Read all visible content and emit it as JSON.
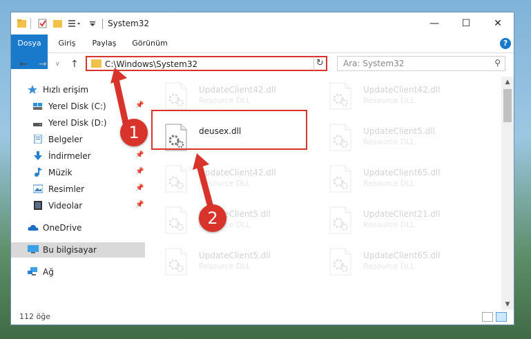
{
  "window": {
    "title": "System32",
    "minimize": "—",
    "maximize": "☐",
    "close": "✕"
  },
  "ribbon": {
    "tabs": [
      "Dosya",
      "Giriş",
      "Paylaş",
      "Görünüm"
    ],
    "help": "?"
  },
  "address": {
    "path": "C:\\Windows\\System32",
    "search_placeholder": "Ara: System32"
  },
  "sidebar": {
    "items": [
      {
        "label": "Hızlı erişim",
        "icon": "star-icon"
      },
      {
        "label": "Yerel Disk (C:)",
        "icon": "drive-icon",
        "pinned": true
      },
      {
        "label": "Yerel Disk (D:)",
        "icon": "drive-icon"
      },
      {
        "label": "Belgeler",
        "icon": "documents-icon",
        "pinned": true
      },
      {
        "label": "İndirmeler",
        "icon": "downloads-icon",
        "pinned": true
      },
      {
        "label": "Müzik",
        "icon": "music-icon",
        "pinned": true
      },
      {
        "label": "Resimler",
        "icon": "pictures-icon",
        "pinned": true
      },
      {
        "label": "Videolar",
        "icon": "videos-icon",
        "pinned": true
      },
      {
        "label": "OneDrive",
        "icon": "cloud-icon"
      },
      {
        "label": "Bu bilgisayar",
        "icon": "computer-icon",
        "selected": true
      },
      {
        "label": "Ağ",
        "icon": "network-icon"
      }
    ]
  },
  "files": [
    {
      "name": "UpdateClient42.dll",
      "type": "Resource DLL"
    },
    {
      "name": "UpdateClient42.dll",
      "type": "Resource DLL"
    },
    {
      "name": "deusex.dll",
      "type": ""
    },
    {
      "name": "UpdateClient5.dll",
      "type": "Resource DLL"
    },
    {
      "name": "UpdateClient42.dll",
      "type": "Resource DLL"
    },
    {
      "name": "UpdateClient65.dll",
      "type": "Resource DLL"
    },
    {
      "name": "UpdateClient5.dll",
      "type": "Resource DLL"
    },
    {
      "name": "UpdateClient21.dll",
      "type": "Resource DLL"
    },
    {
      "name": "UpdateClient5.dll",
      "type": "Resource DLL"
    },
    {
      "name": "UpdateClient65.dll",
      "type": "Resource DLL"
    }
  ],
  "status": {
    "item_count": "112 öğe"
  },
  "annotations": {
    "step1": "1",
    "step2": "2"
  },
  "colors": {
    "accent": "#1979ca",
    "highlight": "#d9342b"
  }
}
